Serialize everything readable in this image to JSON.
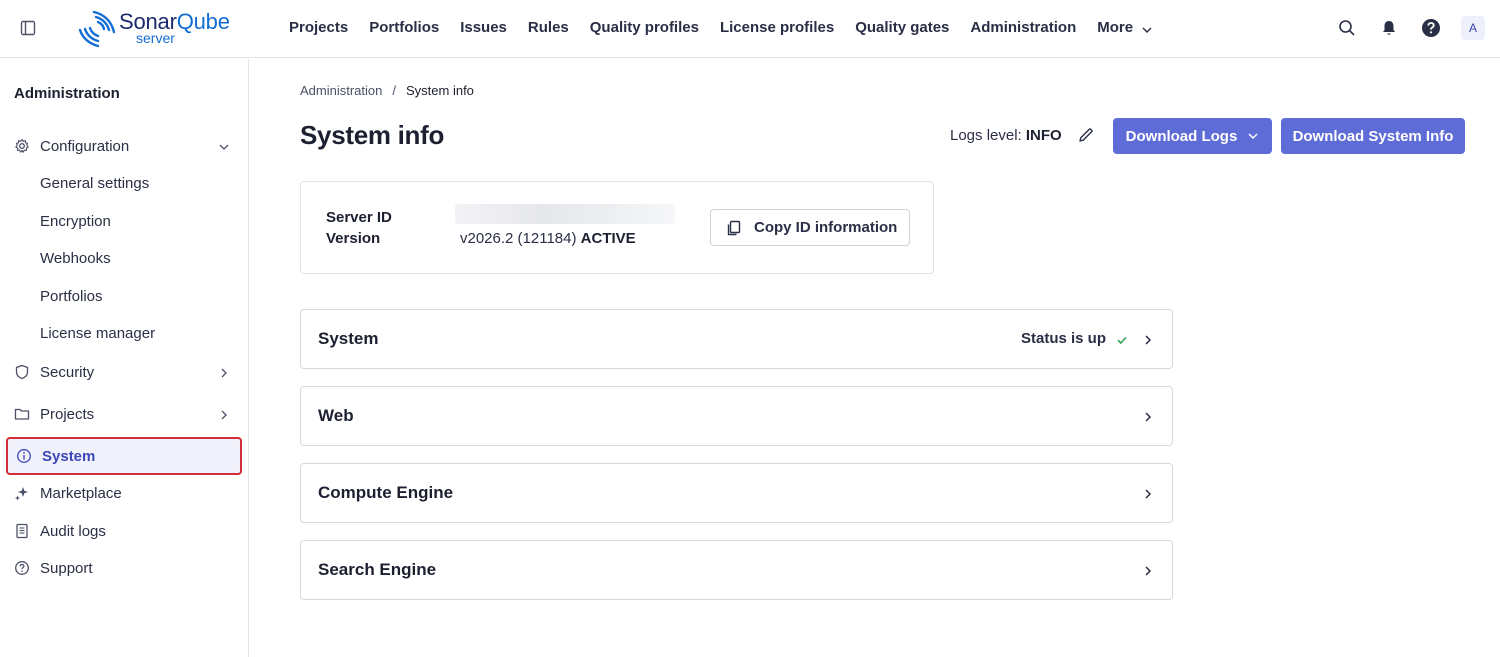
{
  "header": {
    "brand": {
      "name_part1": "Sonar",
      "name_part2": "Qube",
      "sub": "server"
    },
    "nav": [
      "Projects",
      "Portfolios",
      "Issues",
      "Rules",
      "Quality profiles",
      "License profiles",
      "Quality gates",
      "Administration",
      "More"
    ],
    "avatar_initial": "A",
    "icons": [
      "sidebar-toggle-icon",
      "search-icon",
      "bell-icon",
      "help-icon"
    ]
  },
  "sidebar": {
    "title": "Administration",
    "configuration": {
      "label": "Configuration",
      "children": [
        "General settings",
        "Encryption",
        "Webhooks",
        "Portfolios",
        "License manager"
      ]
    },
    "items": [
      {
        "label": "Security",
        "icon": "shield-icon"
      },
      {
        "label": "Projects",
        "icon": "folder-icon"
      },
      {
        "label": "System",
        "icon": "info-icon"
      },
      {
        "label": "Marketplace",
        "icon": "sparkle-icon"
      },
      {
        "label": "Audit logs",
        "icon": "document-icon"
      },
      {
        "label": "Support",
        "icon": "question-icon"
      }
    ],
    "active_item": "System"
  },
  "main": {
    "breadcrumb": {
      "parent": "Administration",
      "separator": "/",
      "current": "System info"
    },
    "title": "System info",
    "logs_level": {
      "label": "Logs level:",
      "value": "INFO"
    },
    "buttons": {
      "download_logs": "Download Logs",
      "download_system_info": "Download System Info"
    },
    "server": {
      "id_label": "Server ID",
      "version_label": "Version",
      "version_value": "v2026.2 (121184)",
      "version_status": "ACTIVE",
      "copy_label": "Copy ID information"
    },
    "sections": [
      {
        "title": "System",
        "status": "Status is up"
      },
      {
        "title": "Web"
      },
      {
        "title": "Compute Engine"
      },
      {
        "title": "Search Engine"
      }
    ]
  },
  "colors": {
    "accent": "#5d6cd6",
    "active_border": "#d02f3a",
    "status_ok": "#2ea44f"
  }
}
